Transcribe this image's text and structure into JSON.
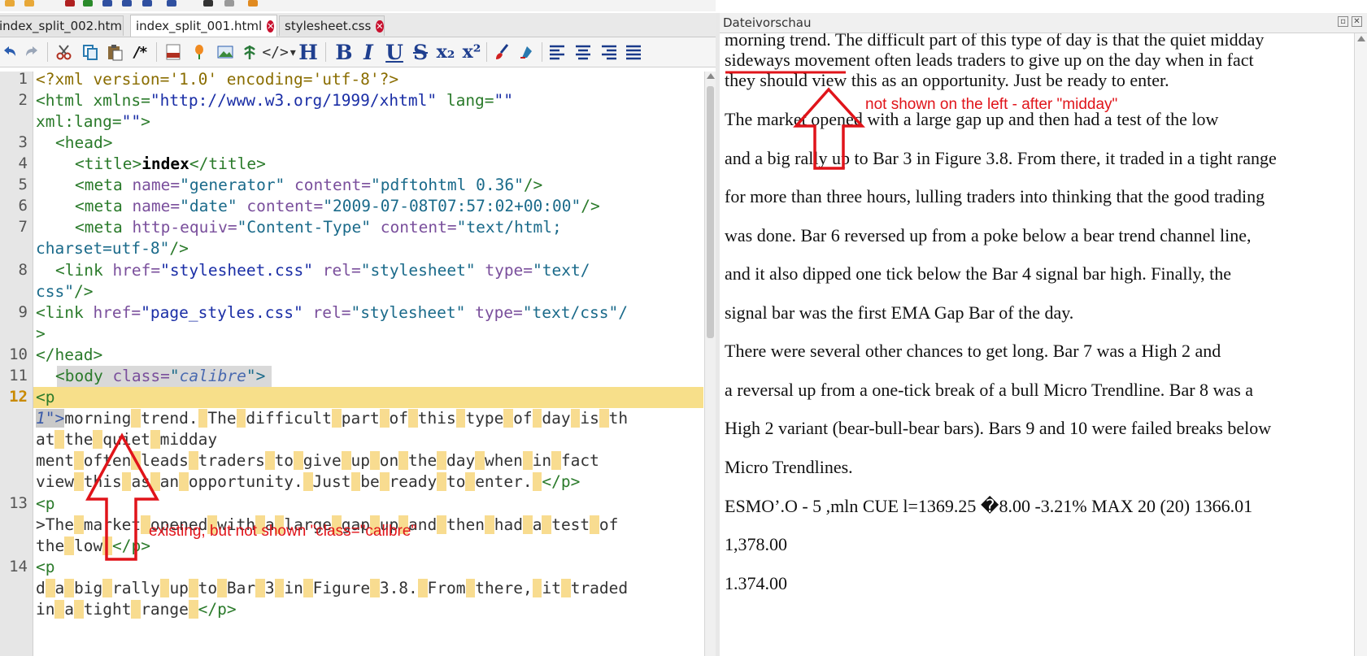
{
  "tabs": [
    {
      "label": "index_split_002.html",
      "active": false
    },
    {
      "label": "index_split_001.html",
      "active": true
    },
    {
      "label": "stylesheet.css",
      "active": false
    }
  ],
  "toolbar": {
    "comment_label": "/*",
    "heading_label": "H",
    "bold_label": "B",
    "italic_label": "I",
    "underline_label": "U",
    "strike_label": "S",
    "subscript_label": "x₂",
    "superscript_label": "x²",
    "icons": [
      "undo-icon",
      "redo-icon",
      "cut-icon",
      "copy-icon",
      "paste-icon",
      "comment-icon",
      "insert-html-icon",
      "insert-image-icon",
      "insert-special-icon",
      "insert-link-icon",
      "code-tag-icon",
      "heading-icon",
      "bold-icon",
      "italic-icon",
      "underline-icon",
      "strikethrough-icon",
      "subscript-icon",
      "superscript-icon",
      "paint-brush-icon",
      "clear-format-icon",
      "align-left-icon",
      "align-center-icon",
      "align-right-icon",
      "justify-icon"
    ]
  },
  "editor": {
    "line_numbers": [
      "1",
      "2",
      "3",
      "4",
      "5",
      "6",
      "7",
      "8",
      "9",
      "10",
      "11",
      "12",
      "13",
      "14"
    ],
    "current_line": "12",
    "lines": {
      "l1": "<?xml version='1.0' encoding='utf-8'?>",
      "l2a_tag": "<html",
      "l2a_attr1": " xmlns=",
      "l2a_val1": "\"http://www.w3.org/1999/xhtml\"",
      "l2a_attr2": " lang=",
      "l2a_val2": "\"\"",
      "l2b_attr": "xml:lang=",
      "l2b_val": "\"\"",
      "l2b_end": ">",
      "l3": "<head>",
      "l4_open": "<title>",
      "l4_text": "index",
      "l4_close": "</title>",
      "l5_tag": "<meta",
      "l5_attr1": " name=",
      "l5_val1": "\"generator\"",
      "l5_attr2": " content=",
      "l5_val2": "\"pdftohtml 0.36\"",
      "l5_end": "/>",
      "l6_tag": "<meta",
      "l6_attr1": " name=",
      "l6_val1": "\"date\"",
      "l6_attr2": " content=",
      "l6_val2": "\"2009-07-08T07:57:02+00:00\"",
      "l6_end": "/>",
      "l7_tag": "<meta",
      "l7_attr1": " http-equiv=",
      "l7_val1": "\"Content-Type\"",
      "l7_attr2": " content=",
      "l7_val2": "\"text/html;",
      "l7b_val": "charset=utf-8\"",
      "l7b_end": "/>",
      "l8_tag": "<link",
      "l8_attr1": " href=",
      "l8_val1": "\"stylesheet.css\"",
      "l8_attr2": " rel=",
      "l8_val2": "\"stylesheet\"",
      "l8_attr3": " type=",
      "l8_val3": "\"text/",
      "l8b_val": "css\"",
      "l8b_end": "/>",
      "l9_tag": "<link",
      "l9_attr1": " href=",
      "l9_val1": "\"page_styles.css\"",
      "l9_attr2": " rel=",
      "l9_val2": "\"stylesheet\"",
      "l9_attr3": " type=",
      "l9_val3": "\"text/css\"/",
      "l9b": ">",
      "l10": "</head>",
      "l11_tag": "<body",
      "l11_attr": " class=",
      "l11_q1": "\"",
      "l11_val": "calibre",
      "l11_q2": "\">",
      "l12a": "<p",
      "l12b_prefix": "1\">",
      "l12b_words": [
        "morning",
        "trend.",
        "The",
        "difficult",
        "part",
        "of",
        "this",
        "type",
        "of",
        "day",
        "is",
        "th"
      ],
      "l12c_words": [
        "at",
        "the",
        "quiet",
        "midday"
      ],
      "l12d_words": [
        "ment",
        "often",
        "leads",
        "traders",
        "to",
        "give",
        "up",
        "on",
        "the",
        "day",
        "when",
        "in",
        "fact"
      ],
      "l12e_words": [
        "view",
        "this",
        "as",
        "an",
        "opportunity.",
        "Just",
        "be",
        "ready",
        "to",
        "enter."
      ],
      "l12e_end": "</p>",
      "l13a": "<p",
      "l13b_words": [
        ">The",
        "market",
        "opened",
        "with",
        "a",
        "large",
        "gap",
        "up",
        "and",
        "then",
        "had",
        "a",
        "test",
        "of"
      ],
      "l13c_words": [
        "the",
        "low"
      ],
      "l13c_end": "</p>",
      "l14a": "<p",
      "l14b_words": [
        "d",
        "a",
        "big",
        "rally",
        "up",
        "to",
        "Bar",
        "3",
        "in",
        "Figure",
        "3.8.",
        "From",
        "there,",
        "it",
        "traded"
      ],
      "l14c_words": [
        "in",
        "a",
        "tight",
        "range"
      ],
      "l14c_end": "</p>"
    }
  },
  "preview": {
    "title": "Dateivorschau",
    "lines": [
      "morning trend. The difficult part of this type of day is that the quiet midday",
      "sideways movement often leads traders to give up on the day when in fact",
      "they should view this as an opportunity. Just be ready to enter.",
      "The market opened with a large gap up and then had a test of the low",
      "and a big rally up to Bar 3 in Figure 3.8. From there, it traded in a tight range",
      "for more than three hours, lulling traders into thinking that the good trading",
      "was  done.  Bar 6 reversed up from a poke below a bear trend channel line,",
      "and  it  also  dipped  one  tick  below the  Bar 4 signal bar  high.  Finally,  the",
      "signal bar was the first EMA Gap Bar of the day.",
      "There were several other chances to  get long.  Bar 7 was a High 2 and",
      "a reversal up from a one-tick break of a bull Micro Trendline.  Bar 8 was a",
      "High 2 variant (bear-bull-bear bars). Bars 9 and  10 were failed breaks below",
      "Micro Trendlines.",
      "ESMO’.O - 5 ,mln  CUE  l=1369.25  �8.00  -3.21%  MAX 20 (20)  1366.01",
      "1,378.00",
      "1.374.00"
    ]
  },
  "annotations": {
    "right_note": "not shown on the left - after \"midday\"",
    "left_note": "existing, but not shown \"class=\"calibre\"",
    "color": "#e0141a"
  },
  "colors": {
    "highlight_line": "#f7df8a",
    "word_space_mark": "#f8dc90",
    "tag_blue": "#17308a",
    "attr_purple": "#7a4f9c",
    "string_blue": "#1a2ea6",
    "close_badge": "#c8102e"
  }
}
